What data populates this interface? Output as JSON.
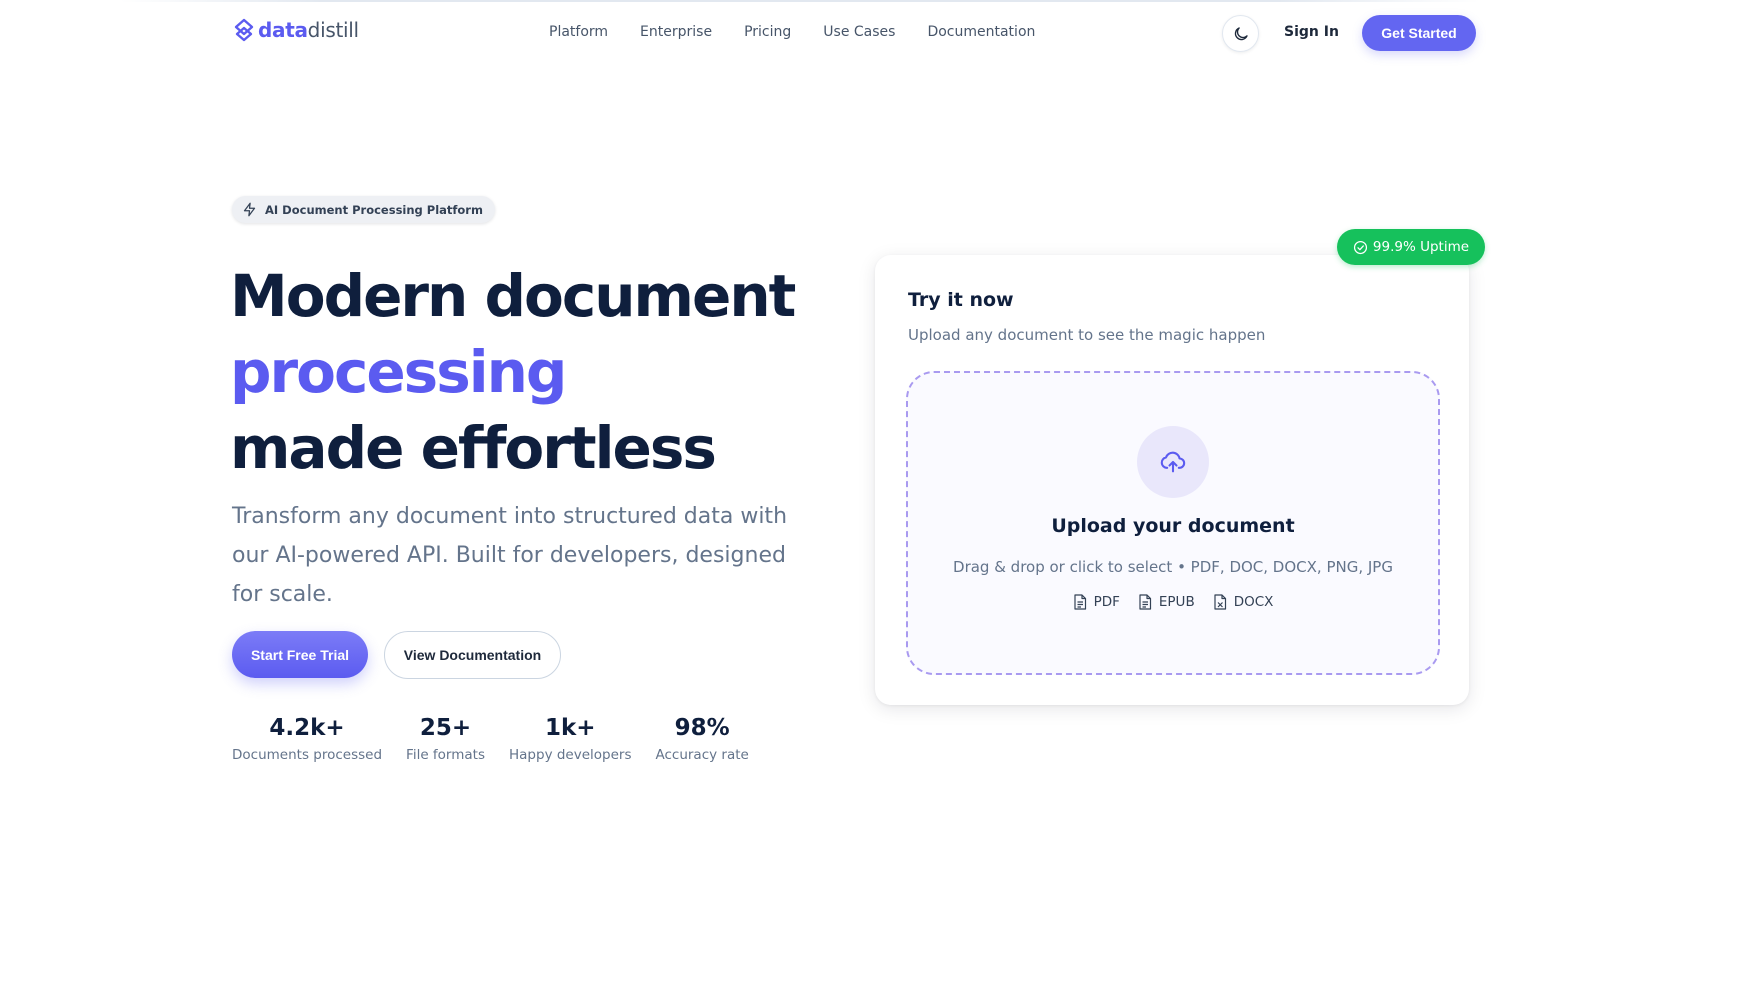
{
  "brand": {
    "part1": "data",
    "part2": "distill",
    "icon": "logo-mark-icon"
  },
  "nav": {
    "links": [
      "Platform",
      "Enterprise",
      "Pricing",
      "Use Cases",
      "Documentation"
    ],
    "theme_icon": "moon-icon",
    "sign_in": "Sign In",
    "get_started": "Get Started"
  },
  "hero": {
    "badge": "AI Document Processing Platform",
    "badge_icon": "lightning-icon",
    "headline_line1": "Modern document",
    "headline_accent": "processing",
    "headline_line3": "made effortless",
    "subtext": "Transform any document into structured data with our AI-powered API. Built for developers, designed for scale.",
    "cta_primary": "Start Free Trial",
    "cta_secondary": "View Documentation",
    "stats": [
      {
        "value": "4.2k+",
        "label": "Documents processed"
      },
      {
        "value": "25+",
        "label": "File formats"
      },
      {
        "value": "1k+",
        "label": "Happy developers"
      },
      {
        "value": "98%",
        "label": "Accuracy rate"
      }
    ]
  },
  "card": {
    "uptime_badge": "99.9% Uptime",
    "title": "Try it now",
    "subtitle": "Upload any document to see the magic happen",
    "dropzone": {
      "icon": "cloud-upload-icon",
      "title": "Upload your document",
      "hint": "Drag & drop or click to select • PDF, DOC, DOCX, PNG, JPG",
      "formats": [
        "PDF",
        "EPUB",
        "DOCX"
      ]
    }
  },
  "colors": {
    "accent": "#5b5bf0",
    "heading": "#0f1f3d",
    "success": "#16c15c",
    "muted": "#64748b"
  }
}
